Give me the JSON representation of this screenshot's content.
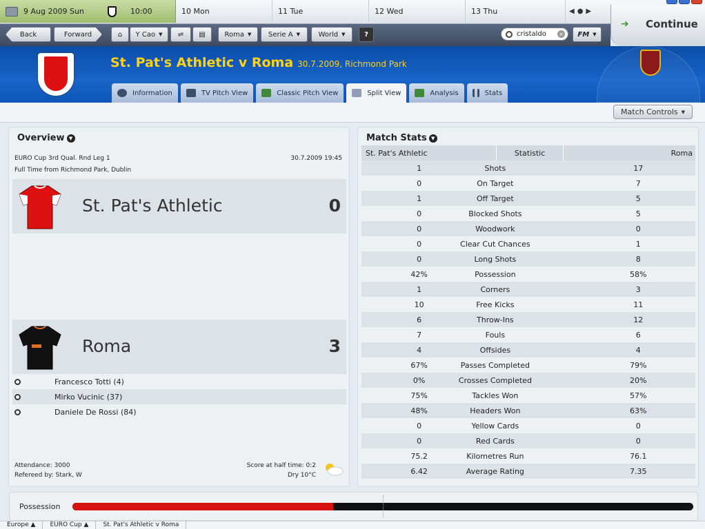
{
  "topbar": {
    "today_date": "9 Aug 2009",
    "today_day": "Sun",
    "time": "10:00",
    "days": [
      {
        "num": "10",
        "day": "Mon"
      },
      {
        "num": "11",
        "day": "Tue"
      },
      {
        "num": "12",
        "day": "Wed"
      },
      {
        "num": "13",
        "day": "Thu"
      }
    ],
    "continue_label": "Continue"
  },
  "navbar": {
    "back": "Back",
    "forward": "Forward",
    "manager": "Y Cao",
    "club": "Roma",
    "league": "Serie A",
    "world": "World",
    "help": "?",
    "search_value": "cristaldo",
    "fm_menu": "FM"
  },
  "header": {
    "title": "St. Pat's Athletic v Roma",
    "subtitle": "30.7.2009, Richmond Park",
    "tabs": [
      "Information",
      "TV Pitch View",
      "Classic Pitch View",
      "Split View",
      "Analysis",
      "Stats"
    ],
    "active_tab": "Split View"
  },
  "subbar": {
    "match_controls": "Match Controls"
  },
  "overview": {
    "title": "Overview",
    "competition": "EURO Cup 3rd Qual. Rnd Leg 1",
    "venue_line": "Full Time from Richmond Park, Dublin",
    "datetime": "30.7.2009 19:45",
    "home": {
      "name": "St. Pat's Athletic",
      "score": "0"
    },
    "away": {
      "name": "Roma",
      "score": "3"
    },
    "scorers": [
      "Francesco Totti (4)",
      "Mirko Vucinic (37)",
      "Daniele De Rossi (84)"
    ],
    "attendance": "Attendance: 3000",
    "referee": "Refereed by: Stark, W",
    "half_time": "Score at half time: 0:2",
    "weather": "Dry 10°C"
  },
  "stats": {
    "title": "Match Stats",
    "headers": [
      "St. Pat's Athletic",
      "Statistic",
      "Roma"
    ],
    "rows": [
      [
        "1",
        "Shots",
        "17"
      ],
      [
        "0",
        "On Target",
        "7"
      ],
      [
        "1",
        "Off Target",
        "5"
      ],
      [
        "0",
        "Blocked Shots",
        "5"
      ],
      [
        "0",
        "Woodwork",
        "0"
      ],
      [
        "0",
        "Clear Cut Chances",
        "1"
      ],
      [
        "0",
        "Long Shots",
        "8"
      ],
      [
        "42%",
        "Possession",
        "58%"
      ],
      [
        "1",
        "Corners",
        "3"
      ],
      [
        "10",
        "Free Kicks",
        "11"
      ],
      [
        "6",
        "Throw-Ins",
        "12"
      ],
      [
        "7",
        "Fouls",
        "6"
      ],
      [
        "4",
        "Offsides",
        "4"
      ],
      [
        "67%",
        "Passes Completed",
        "79%"
      ],
      [
        "0%",
        "Crosses Completed",
        "20%"
      ],
      [
        "75%",
        "Tackles Won",
        "57%"
      ],
      [
        "48%",
        "Headers Won",
        "63%"
      ],
      [
        "0",
        "Yellow Cards",
        "0"
      ],
      [
        "0",
        "Red Cards",
        "0"
      ],
      [
        "75.2",
        "Kilometres Run",
        "76.1"
      ],
      [
        "6.42",
        "Average Rating",
        "7.35"
      ]
    ]
  },
  "possession": {
    "label": "Possession",
    "home_share": 0.42,
    "home_color": "#d70f0f",
    "away_color": "#111111"
  },
  "footer": {
    "crumbs": [
      "Europe",
      "EURO Cup",
      "St. Pat's Athletic v Roma"
    ]
  }
}
